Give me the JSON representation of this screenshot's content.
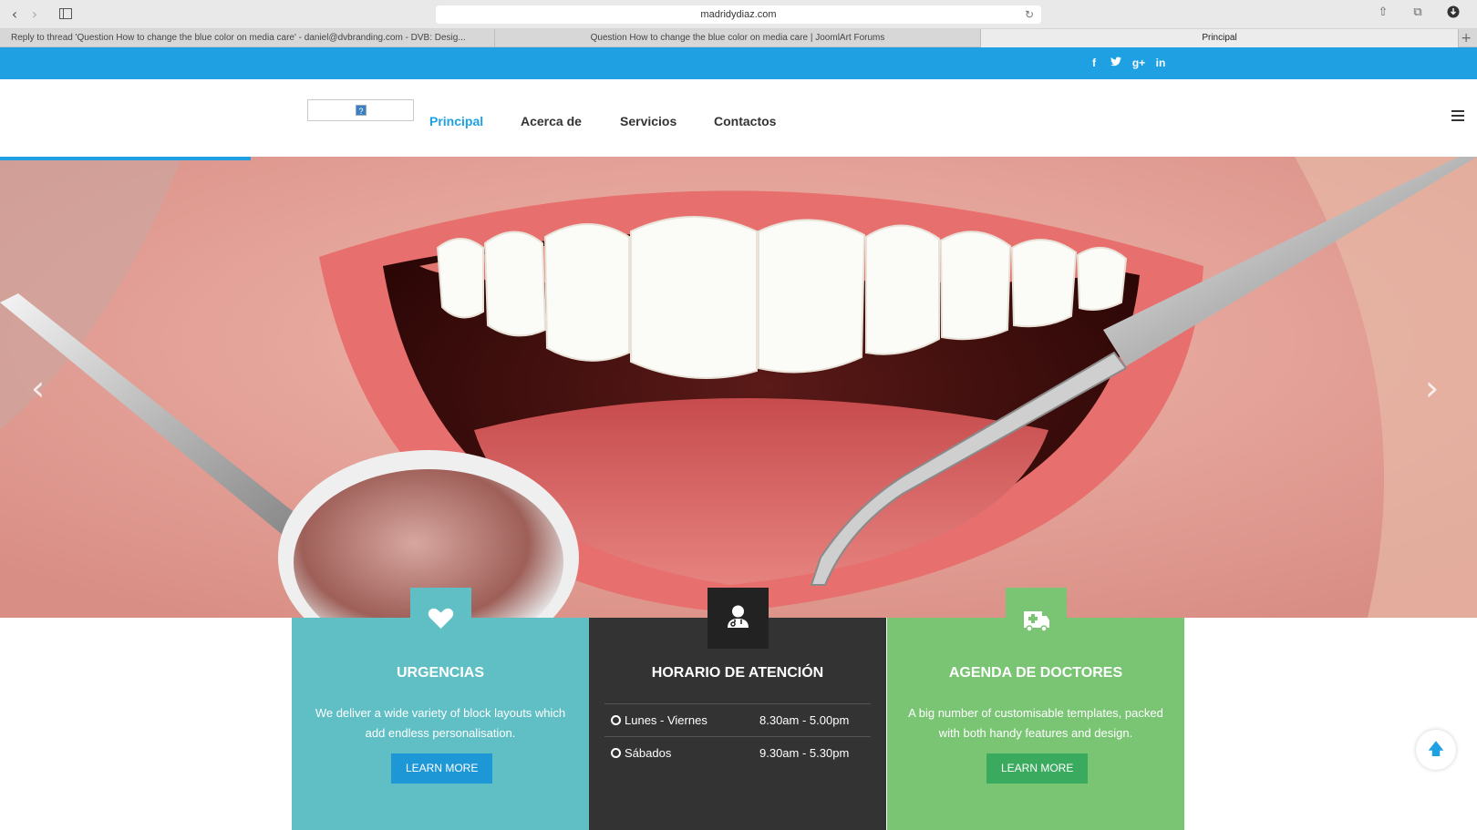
{
  "browser": {
    "url": "madridydiaz.com",
    "tabs": [
      {
        "label": "Reply to thread 'Question How to change the blue color on media care' - daniel@dvbranding.com - DVB: Desig..."
      },
      {
        "label": "Question How to change the blue color on media care | JoomlArt Forums"
      },
      {
        "label": "Principal"
      }
    ]
  },
  "nav": {
    "items": [
      "Principal",
      "Acerca de",
      "Servicios",
      "Contactos"
    ],
    "active": "Principal"
  },
  "colors": {
    "brand_blue": "#1ea0e2",
    "urgencias": "#5fbfc4",
    "horario": "#333333",
    "agenda": "#7ac574",
    "learn_more_blue": "#1e97d6",
    "learn_more_green": "#3aab5e"
  },
  "social": [
    "facebook-icon",
    "twitter-icon",
    "google-plus-icon",
    "linkedin-icon"
  ],
  "boxes": {
    "urgencias": {
      "icon": "heart-icon",
      "title": "URGENCIAS",
      "text": "We deliver a wide variety of block layouts which add endless personalisation.",
      "button": "LEARN MORE"
    },
    "horario": {
      "icon": "doctor-icon",
      "title": "HORARIO DE ATENCIÓN",
      "rows": [
        {
          "day": "Lunes - Viernes",
          "time": "8.30am - 5.00pm"
        },
        {
          "day": "Sábados",
          "time": "9.30am - 5.30pm"
        }
      ]
    },
    "agenda": {
      "icon": "ambulance-icon",
      "title": "AGENDA DE DOCTORES",
      "text": "A big number of customisable templates, packed with both handy features and design.",
      "button": "LEARN MORE"
    }
  }
}
